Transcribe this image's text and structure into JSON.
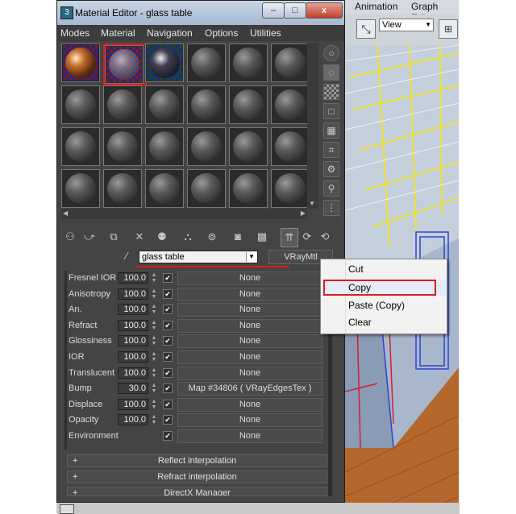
{
  "window": {
    "title": "Material Editor - glass table",
    "controls": {
      "minimize": "–",
      "maximize": "□",
      "close": "x"
    }
  },
  "menu": [
    "Modes",
    "Material",
    "Navigation",
    "Options",
    "Utilities"
  ],
  "background_app": {
    "menu": [
      "Animation",
      "Graph Edito"
    ],
    "view_dropdown": "View"
  },
  "material": {
    "name": "glass table",
    "type": "VRayMtl"
  },
  "maps_rows": [
    {
      "label": "Fresnel IOR",
      "value": "100.0",
      "checked": true,
      "map": "None"
    },
    {
      "label": "Anisotropy",
      "value": "100.0",
      "checked": true,
      "map": "None"
    },
    {
      "label": "An.",
      "value": "100.0",
      "checked": true,
      "map": "None"
    },
    {
      "label": "Refract",
      "value": "100.0",
      "checked": true,
      "map": "None"
    },
    {
      "label": "Glossiness",
      "value": "100.0",
      "checked": true,
      "map": "None"
    },
    {
      "label": "IOR",
      "value": "100.0",
      "checked": true,
      "map": "None"
    },
    {
      "label": "Translucent",
      "value": "100.0",
      "checked": true,
      "map": "None"
    },
    {
      "label": "Bump",
      "value": "30.0",
      "checked": true,
      "map": "Map #34806  ( VRayEdgesTex )"
    },
    {
      "label": "Displace",
      "value": "100.0",
      "checked": true,
      "map": "None"
    },
    {
      "label": "Opacity",
      "value": "100.0",
      "checked": true,
      "map": "None"
    },
    {
      "label": "Environment",
      "value": "",
      "checked": true,
      "map": "None"
    }
  ],
  "rollouts": [
    {
      "sign": "+",
      "label": "Reflect interpolation"
    },
    {
      "sign": "+",
      "label": "Refract interpolation"
    },
    {
      "sign": "+",
      "label": "DirectX Manager"
    }
  ],
  "context_menu": {
    "items": [
      "Cut",
      "Copy",
      "Paste (Copy)",
      "Clear"
    ],
    "highlighted": "Copy"
  },
  "colors": {
    "highlight_red": "#e01a1a",
    "panel_bg": "#444444",
    "floor_wood": "#b5682c",
    "ceiling_yellow": "#f0e030"
  }
}
